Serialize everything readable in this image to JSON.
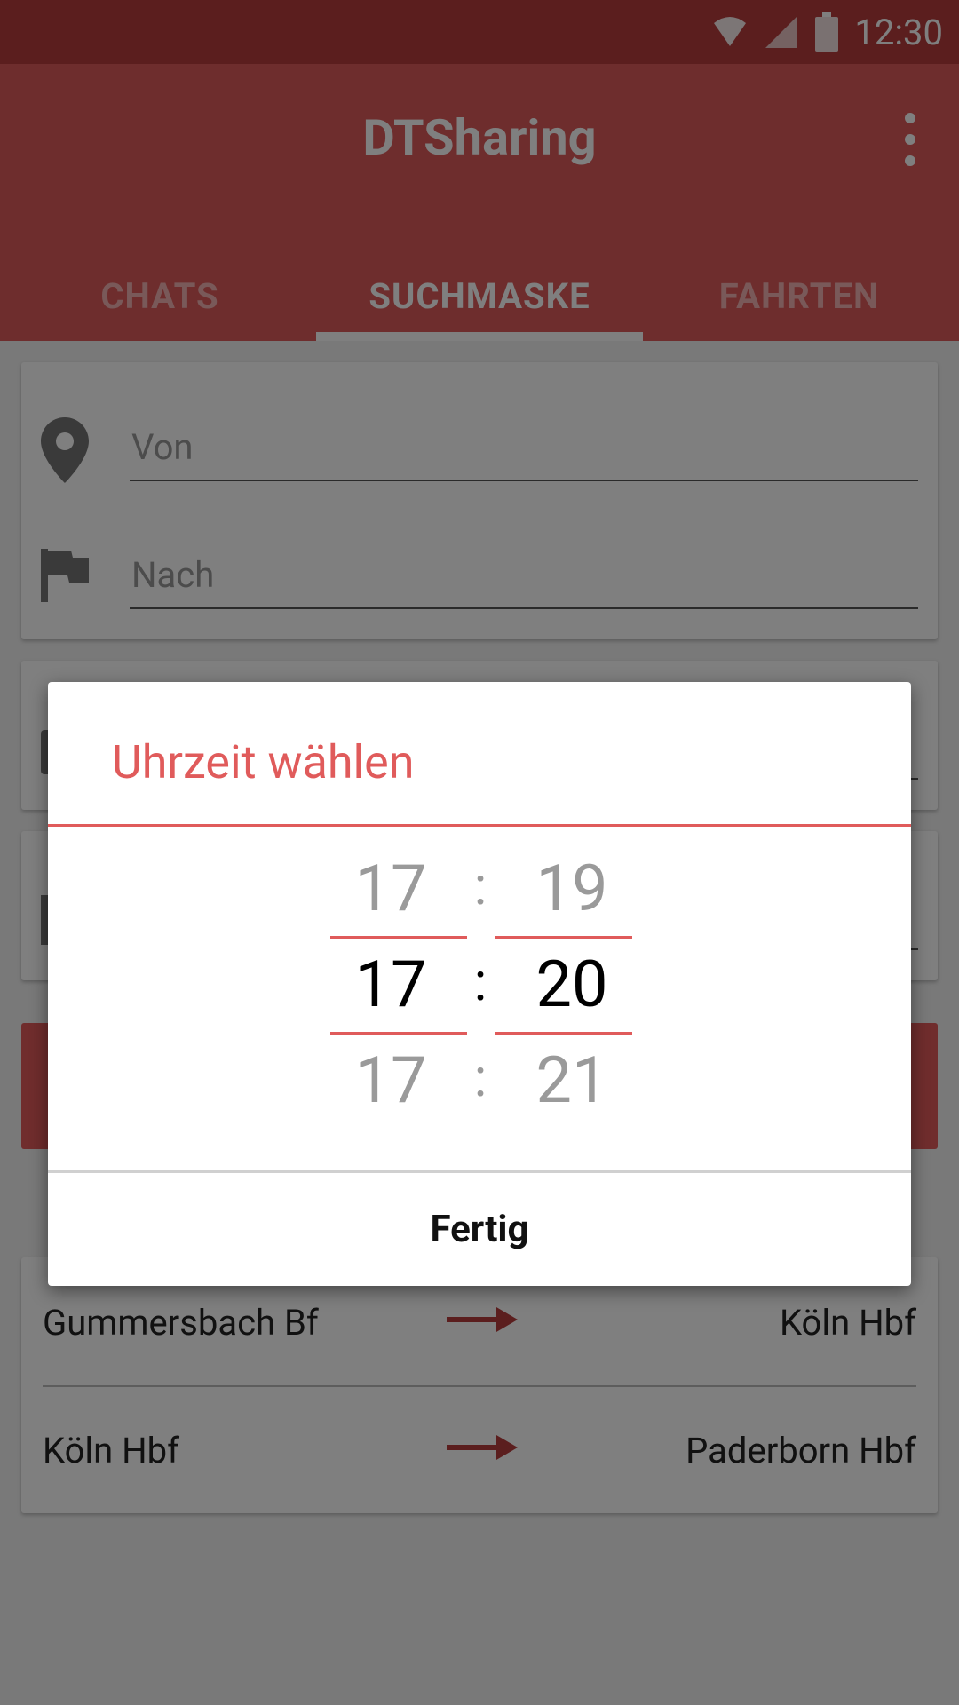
{
  "status_bar": {
    "time": "12:30",
    "icons": [
      "wifi-icon",
      "cell-signal-icon",
      "battery-icon"
    ]
  },
  "app_bar": {
    "title": "DTSharing",
    "menu_icon": "more-vert-icon"
  },
  "tabs": [
    {
      "label": "CHATS",
      "active": false
    },
    {
      "label": "SUCHMASKE",
      "active": true
    },
    {
      "label": "FAHRTEN",
      "active": false
    }
  ],
  "search": {
    "from_placeholder": "Von",
    "to_placeholder": "Nach",
    "from_icon": "location-pin-icon",
    "to_icon": "flag-icon"
  },
  "routes": [
    {
      "from": "Gummersbach Bf",
      "to": "Köln Hbf"
    },
    {
      "from": "Köln Hbf",
      "to": "Paderborn Hbf"
    }
  ],
  "dialog": {
    "title": "Uhrzeit wählen",
    "hours": {
      "prev": "17",
      "selected": "17",
      "next": "17"
    },
    "minutes": {
      "prev": "19",
      "selected": "20",
      "next": "21"
    },
    "separator": ":",
    "done_label": "Fertig"
  },
  "colors": {
    "primary": "#dc5a5a",
    "primary_dark": "#b73c3c",
    "accent": "#e05b5b"
  }
}
